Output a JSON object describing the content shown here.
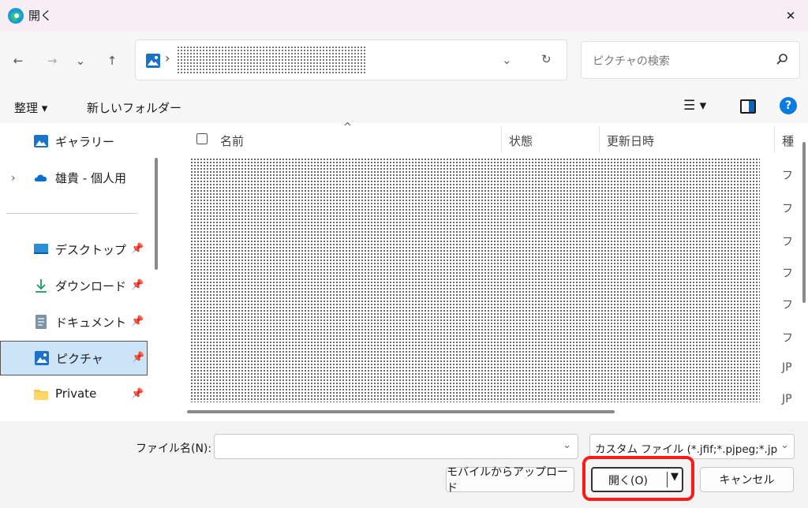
{
  "window": {
    "title": "開く",
    "close_glyph": "✕"
  },
  "nav": {
    "back_glyph": "←",
    "forward_glyph": "→",
    "recent_glyph": "⌄",
    "up_glyph": "↑",
    "address_chevron": "›",
    "address_dropdown_glyph": "⌄",
    "refresh_glyph": "↻",
    "search_placeholder": "ピクチャの検索"
  },
  "toolbar": {
    "organize_label": "整理 ▾",
    "new_folder_label": "新しいフォルダー",
    "view_label": "☰ ▾",
    "help_label": "?"
  },
  "sidebar": {
    "items": [
      {
        "label": "ギャラリー",
        "icon": "gallery-icon"
      },
      {
        "label": "雄貴 - 個人用",
        "icon": "onedrive-icon",
        "expand": "›"
      },
      {
        "label": "デスクトップ",
        "icon": "desktop-icon",
        "pin": "📌"
      },
      {
        "label": "ダウンロード",
        "icon": "download-icon",
        "pin": "📌"
      },
      {
        "label": "ドキュメント",
        "icon": "documents-icon",
        "pin": "📌"
      },
      {
        "label": "ピクチャ",
        "icon": "pictures-icon",
        "pin": "📌",
        "selected": true
      },
      {
        "label": "Private",
        "icon": "folder-icon",
        "pin": "📌"
      }
    ]
  },
  "filelist": {
    "columns": {
      "name": "名前",
      "status": "状態",
      "modified": "更新日時",
      "type": "種"
    },
    "sort_glyph": "^",
    "type_cells": [
      "フ",
      "フ",
      "フ",
      "フ",
      "フ",
      "フ",
      "JP",
      "JP"
    ]
  },
  "bottom": {
    "filename_label": "ファイル名(N):",
    "filename_value": "",
    "filename_dd": "⌄",
    "filetype_value": "カスタム ファイル (*.jfif;*.pjpeg;*.jp",
    "filetype_dd": "⌄",
    "upload_label": "モバイルからアップロード",
    "open_label": "開く(O)",
    "open_arrow": "▼",
    "cancel_label": "キャンセル"
  },
  "colors": {
    "accent": "#0067c0",
    "highlight": "#ff1a1a",
    "selected_bg": "#cce4f7"
  }
}
